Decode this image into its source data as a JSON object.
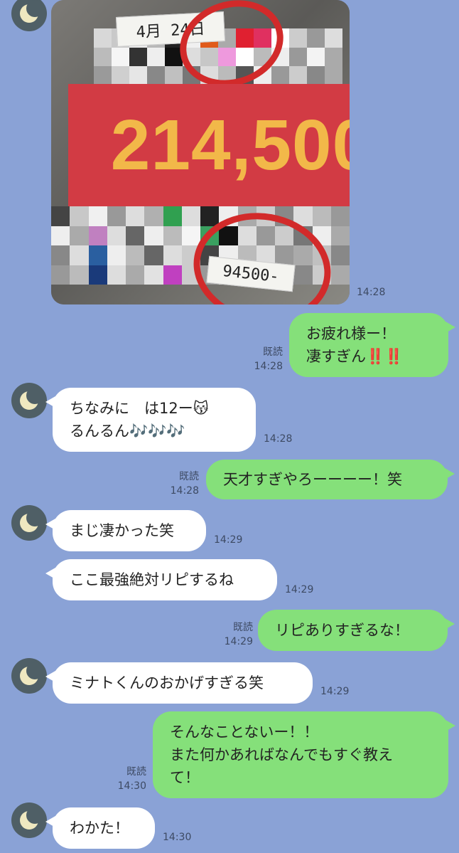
{
  "image_message": {
    "banner_amount": "214,500",
    "note_date": "4月 24日",
    "note_amount": "94500-",
    "time": "14:28"
  },
  "messages": [
    {
      "id": "m1",
      "side": "out",
      "lines": [
        "お疲れ様ー！",
        "凄すぎん‼️‼️"
      ],
      "read": "既読",
      "time": "14:28"
    },
    {
      "id": "m2",
      "side": "in",
      "lines": [
        "ちなみに　は12ー😽",
        "るんるん🎶🎶🎶"
      ],
      "time": "14:28"
    },
    {
      "id": "m3",
      "side": "out",
      "lines": [
        "天才すぎやろーーーー！笑"
      ],
      "read": "既読",
      "time": "14:28"
    },
    {
      "id": "m4",
      "side": "in",
      "lines": [
        "まじ凄かった笑"
      ],
      "time": "14:29"
    },
    {
      "id": "m5",
      "side": "in",
      "lines": [
        "ここ最強絶対リピするね"
      ],
      "time": "14:29"
    },
    {
      "id": "m6",
      "side": "out",
      "lines": [
        "リピありすぎるな！"
      ],
      "read": "既読",
      "time": "14:29"
    },
    {
      "id": "m7",
      "side": "in",
      "lines": [
        "ミナトくんのおかげすぎる笑"
      ],
      "time": "14:29"
    },
    {
      "id": "m8",
      "side": "out",
      "lines": [
        "そんなことないー！！",
        "また何かあればなんでもすぐ教え",
        "て！"
      ],
      "read": "既読",
      "time": "14:30"
    },
    {
      "id": "m9",
      "side": "in",
      "lines": [
        "わかた！"
      ],
      "time": "14:30"
    }
  ],
  "avatar_icon": "crescent-moon-icon",
  "colors": {
    "background": "#8aa2d6",
    "incoming": "#ffffff",
    "outgoing": "#85e07a",
    "banner": "#d23b44",
    "amount": "#f2b849",
    "circle": "#d22a2a"
  }
}
